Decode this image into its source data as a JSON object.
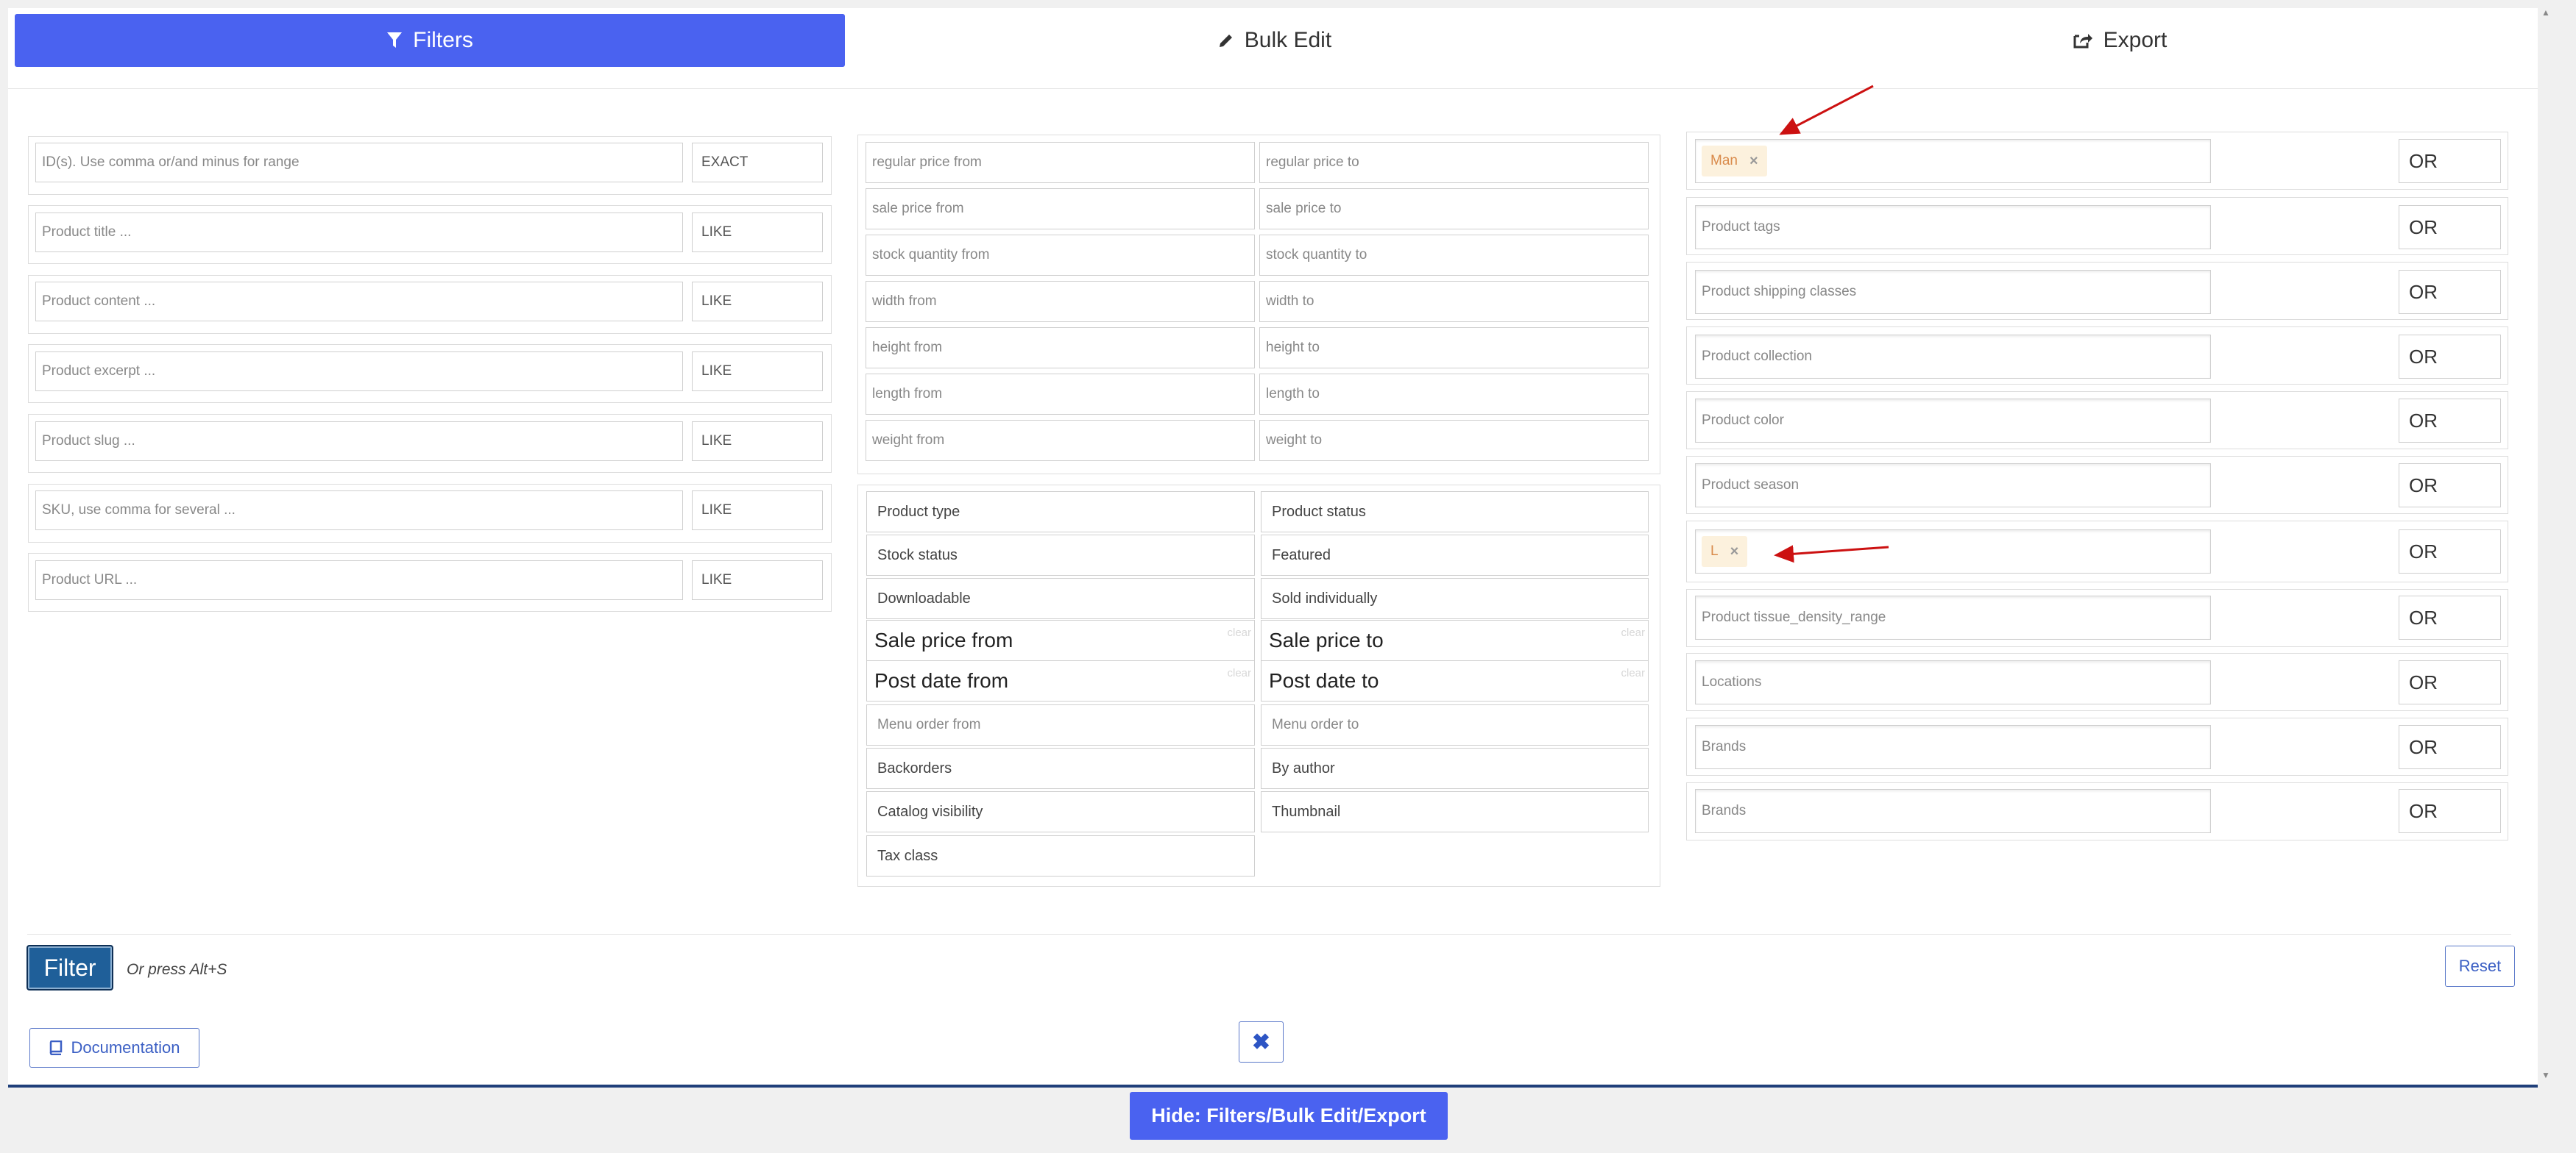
{
  "tabs": [
    {
      "label": "Filters",
      "icon": "filter-icon",
      "active": true
    },
    {
      "label": "Bulk Edit",
      "icon": "pencil-icon",
      "active": false
    },
    {
      "label": "Export",
      "icon": "export-icon",
      "active": false
    }
  ],
  "text_filters": [
    {
      "placeholder": "ID(s). Use comma or/and minus for range",
      "operator": "EXACT"
    },
    {
      "placeholder": "Product title ...",
      "operator": "LIKE"
    },
    {
      "placeholder": "Product content ...",
      "operator": "LIKE"
    },
    {
      "placeholder": "Product excerpt ...",
      "operator": "LIKE"
    },
    {
      "placeholder": "Product slug ...",
      "operator": "LIKE"
    },
    {
      "placeholder": "SKU, use comma for several ...",
      "operator": "LIKE"
    },
    {
      "placeholder": "Product URL ...",
      "operator": "LIKE"
    }
  ],
  "range_filters": [
    {
      "from": "regular price from",
      "to": "regular price to"
    },
    {
      "from": "sale price from",
      "to": "sale price to"
    },
    {
      "from": "stock quantity from",
      "to": "stock quantity to"
    },
    {
      "from": "width from",
      "to": "width to"
    },
    {
      "from": "height from",
      "to": "height to"
    },
    {
      "from": "length from",
      "to": "length to"
    },
    {
      "from": "weight from",
      "to": "weight to"
    }
  ],
  "select_filters": {
    "product_type": "Product type",
    "product_status": "Product status",
    "stock_status": "Stock status",
    "featured": "Featured",
    "downloadable": "Downloadable",
    "sold_individually": "Sold individually",
    "sale_price_from": "Sale price from",
    "sale_price_to": "Sale price to",
    "post_date_from": "Post date from",
    "post_date_to": "Post date to",
    "clear_label": "clear",
    "menu_order_from": "Menu order from",
    "menu_order_to": "Menu order to",
    "backorders": "Backorders",
    "by_author": "By author",
    "catalog_visibility": "Catalog visibility",
    "thumbnail": "Thumbnail",
    "tax_class": "Tax class"
  },
  "taxonomy_filters": [
    {
      "placeholder": "",
      "chip": "Man",
      "operator": "OR"
    },
    {
      "placeholder": "Product tags",
      "chip": null,
      "operator": "OR"
    },
    {
      "placeholder": "Product shipping classes",
      "chip": null,
      "operator": "OR"
    },
    {
      "placeholder": "Product collection",
      "chip": null,
      "operator": "OR"
    },
    {
      "placeholder": "Product color",
      "chip": null,
      "operator": "OR"
    },
    {
      "placeholder": "Product season",
      "chip": null,
      "operator": "OR"
    },
    {
      "placeholder": "",
      "chip": "L",
      "operator": "OR"
    },
    {
      "placeholder": "Product tissue_density_range",
      "chip": null,
      "operator": "OR"
    },
    {
      "placeholder": "Locations",
      "chip": null,
      "operator": "OR"
    },
    {
      "placeholder": "Brands",
      "chip": null,
      "operator": "OR"
    },
    {
      "placeholder": "Brands",
      "chip": null,
      "operator": "OR"
    }
  ],
  "chip_remove": "×",
  "actions": {
    "filter_label": "Filter",
    "hint": "Or press Alt+S",
    "reset_label": "Reset",
    "documentation_label": "Documentation",
    "close_symbol": "✖",
    "hide_label": "Hide: Filters/Bulk Edit/Export"
  },
  "colors": {
    "accent": "#4a62f0",
    "filter_button": "#1f5f99",
    "chip_bg": "#fcf1dd",
    "chip_text": "#d98a4a",
    "annotation_arrow": "#cc1111"
  }
}
